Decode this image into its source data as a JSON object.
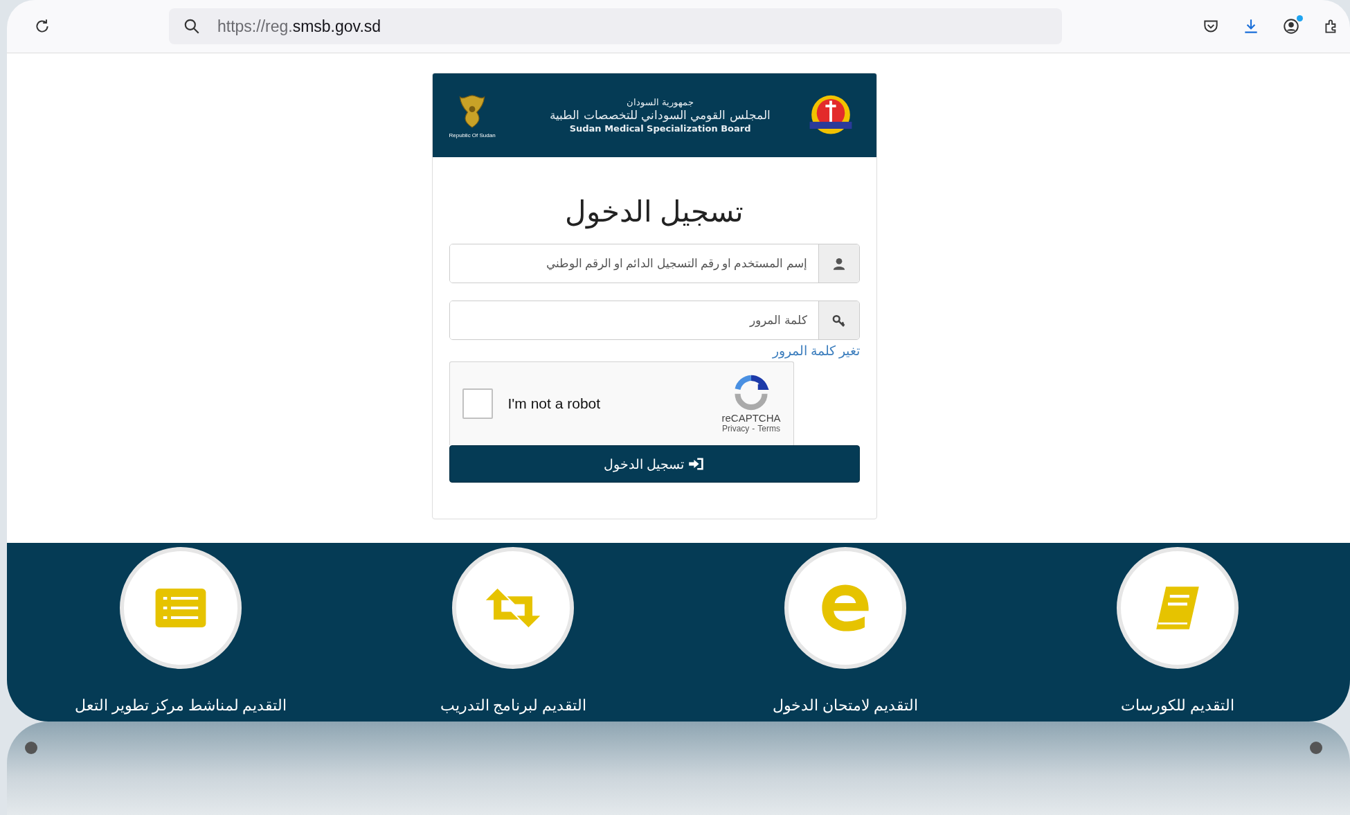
{
  "browser": {
    "url_prefix": "https://reg.",
    "url_domain": "smsb.gov.sd",
    "download_badge": true
  },
  "header": {
    "emblem_caption": "Republic Of Sudan",
    "arabic_line_1": "جمهورية السودان",
    "arabic_line_2": "المجلس القومي السوداني للتخصصات الطبية",
    "english_name": "Sudan Medical Specialization Board"
  },
  "login": {
    "title": "تسجيل الدخول",
    "fields": [
      {
        "kind": "user",
        "placeholder": "إسم المستخدم او رقم التسجيل الدائم او الرقم الوطني"
      },
      {
        "kind": "password",
        "placeholder": "كلمة المرور"
      }
    ],
    "change_password_link": "تغير كلمة المرور",
    "captcha": {
      "label": "I'm not a robot",
      "checked": false,
      "brand": "reCAPTCHA",
      "privacy": "Privacy",
      "separator": "-",
      "terms": "Terms"
    },
    "submit": "تسجيل الدخول"
  },
  "services": [
    {
      "kind": "book",
      "label": "التقديم للكورسات"
    },
    {
      "kind": "letter-e",
      "label": "التقديم لامتحان الدخول"
    },
    {
      "kind": "swap",
      "label": "التقديم لبرنامج التدريب"
    },
    {
      "kind": "list",
      "label": "التقديم لمناشط مركز تطوير التعل"
    }
  ]
}
